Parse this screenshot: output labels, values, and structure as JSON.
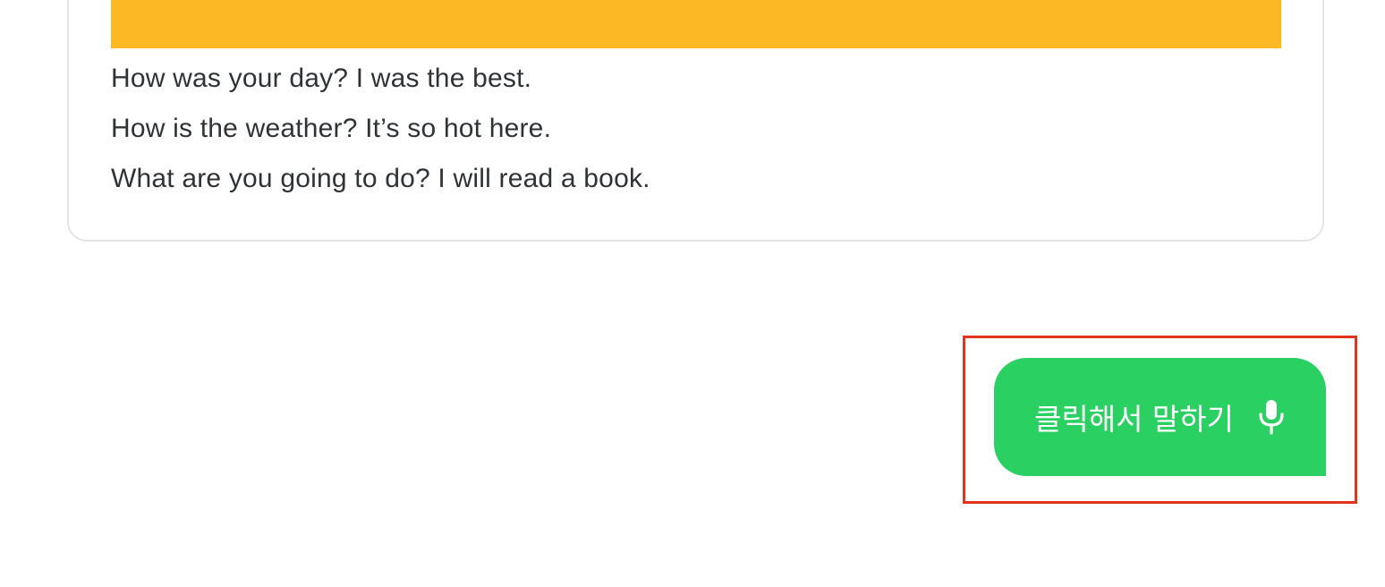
{
  "card": {
    "banner_color": "#fdb924",
    "sentences": [
      "How was your day? I was the best.",
      "How is the weather? It’s so hot here.",
      "What are you going to do? I will read a book."
    ]
  },
  "speak_button": {
    "label": "클릭해서 말하기",
    "icon": "microphone-icon",
    "background": "#2bd062"
  },
  "highlight": {
    "color": "#e2341d"
  }
}
